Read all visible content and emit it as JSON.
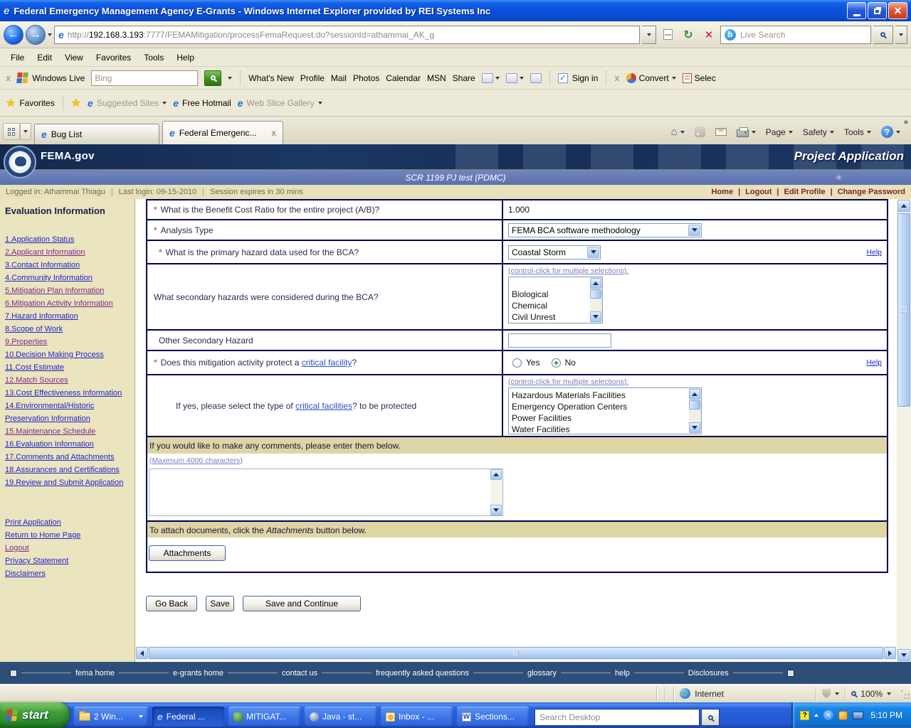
{
  "window": {
    "title": "Federal Emergency Management Agency E-Grants - Windows Internet Explorer provided by REI Systems Inc"
  },
  "address_bar": {
    "url_protocol": "http://",
    "url_host": "192.168.3.193",
    "url_path": ":7777/FEMAMitigation/processFemaRequest.do?sessionId=athammai_AK_g",
    "live_search_placeholder": "Live Search"
  },
  "menu": {
    "items": [
      "File",
      "Edit",
      "View",
      "Favorites",
      "Tools",
      "Help"
    ]
  },
  "live_toolbar": {
    "brand": "Windows Live",
    "search_placeholder": "Bing",
    "links": [
      "What's New",
      "Profile",
      "Mail",
      "Photos",
      "Calendar",
      "MSN",
      "Share"
    ],
    "sign_in": "Sign in",
    "convert": "Convert",
    "select_partial": "Selec"
  },
  "favorites_bar": {
    "favorites": "Favorites",
    "suggested_sites": "Suggested Sites",
    "free_hotmail": "Free Hotmail",
    "web_slice_gallery": "Web Slice Gallery"
  },
  "tabs": {
    "bug_list": "Bug List",
    "active_tab": "Federal Emergenc..."
  },
  "command_bar": {
    "page": "Page",
    "safety": "Safety",
    "tools": "Tools"
  },
  "site": {
    "brand": "FEMA.gov",
    "app_title": "Project Application",
    "record_title": "SCR 1199 PJ test (PDMC)",
    "logged_in": "Logged in: Athammai Thiagu",
    "last_login": "Last login: 09-15-2010",
    "session": "Session expires in 30 mins",
    "nav": {
      "home": "Home",
      "logout": "Logout",
      "edit_profile": "Edit Profile",
      "change_password": "Change Password"
    }
  },
  "sidebar": {
    "heading": "Evaluation Information",
    "items": [
      "1.Application Status",
      "2.Applicant Information",
      "3.Contact Information",
      "4.Community Information",
      "5.Mitigation Plan Information",
      "6.Mitigation Activity Information",
      "7.Hazard Information",
      "8.Scope of Work",
      "9.Properties",
      "10.Decision Making Process",
      "11.Cost Estimate",
      "12.Match Sources",
      "13.Cost Effectiveness Information",
      "14.Environmental/Historic Preservation Information",
      "15.Maintenance Schedule",
      "16.Evaluation Information",
      "17.Comments and Attachments",
      "18.Assurances and Certifications",
      "19.Review and Submit Application"
    ],
    "links": [
      "Print Application",
      "Return to Home Page",
      "Logout",
      "Privacy Statement",
      "Disclaimers"
    ]
  },
  "form": {
    "bcr_label": "What is the Benefit Cost Ratio for the entire project (A/B)?",
    "bcr_value": "1.000",
    "analysis_label": "Analysis Type",
    "analysis_value": "FEMA BCA software methodology",
    "primary_label": "What is the primary hazard data used for the BCA?",
    "primary_value": "Coastal Storm",
    "help_link": "Help",
    "multi_select_hint": "(control-click for multiple selections):",
    "secondary_label": "What secondary hazards were considered during the BCA?",
    "secondary_options": [
      "Biological",
      "Chemical",
      "Civil Unrest"
    ],
    "other_label": "Other Secondary Hazard",
    "critical_q_pre": "Does this mitigation activity protect a ",
    "critical_q_link": "critical facility",
    "critical_q_post": "?",
    "radio_yes": "Yes",
    "radio_no": "No",
    "radio_selected": "No",
    "types_pre": "If yes, please select the type of ",
    "types_link": "critical facilities",
    "types_post": "? to be protected",
    "types_options": [
      "Hazardous Materials Facilities",
      "Emergency Operation Centers",
      "Power Facilities",
      "Water Facilities"
    ],
    "comments_header": "If you would like to make any comments, please enter them below.",
    "comments_hint": "(Maximum 4000 characters)",
    "attach_pre": "To attach documents, click the ",
    "attach_button_word": "Attachments",
    "attach_post": " button below.",
    "attachments_button": "Attachments",
    "go_back": "Go Back",
    "save": "Save",
    "save_and_continue": "Save and Continue"
  },
  "footer": {
    "links": [
      "fema home",
      "e-grants home",
      "contact us",
      "frequently asked questions",
      "glossary",
      "help",
      "Disclosures"
    ]
  },
  "status_bar": {
    "zone": "Internet",
    "zoom_level": "100%"
  },
  "taskbar": {
    "start": "start",
    "group_button": "2 Win...",
    "buttons": [
      "Federal ...",
      "MITIGAT...",
      "Java - st...",
      "Inbox - ...",
      "Sections..."
    ],
    "search_placeholder": "Search Desktop",
    "clock": "5:10 PM"
  },
  "colors": {
    "titlebar_blue": "#0b51dd",
    "header_navy": "#1b3764",
    "subheader_blue": "#6579b5",
    "tan_band": "#ddd5a4",
    "sidebar_bg": "#eae4bf",
    "table_border": "#000050",
    "link_blue": "#2323cb",
    "visited_purple": "#7b2a8b",
    "maroon_link": "#7d2332",
    "taskbar_blue": "#2a63e0",
    "start_green": "#3f9c3a"
  }
}
